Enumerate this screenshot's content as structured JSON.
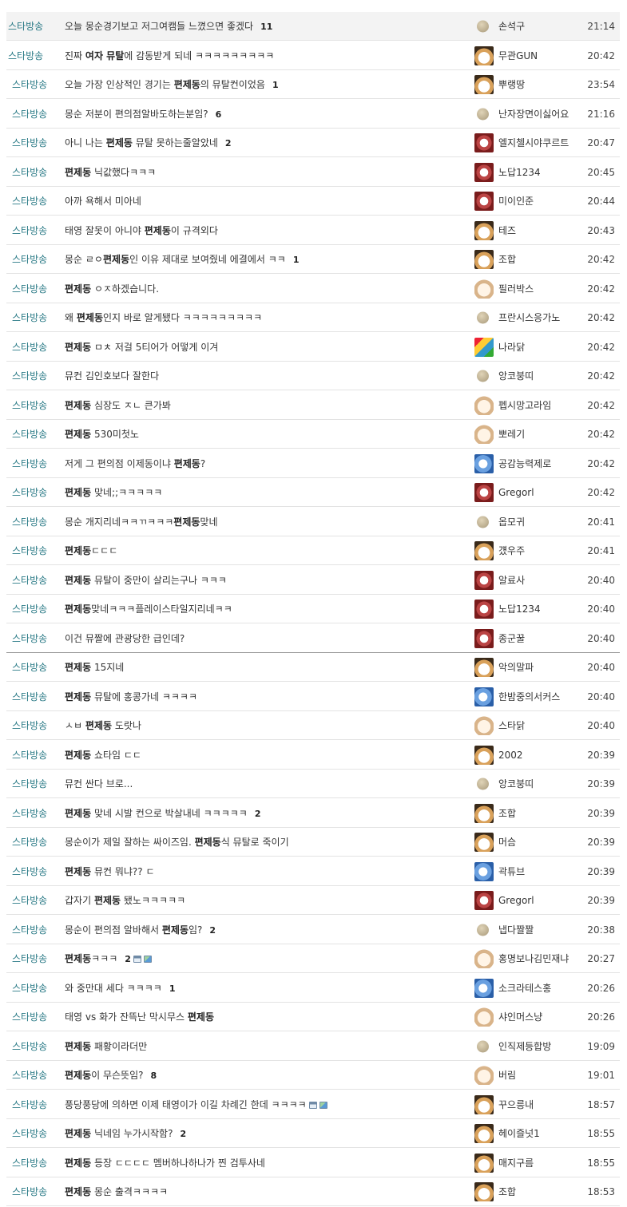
{
  "rows": [
    {
      "cat": "스타방송",
      "parts": [
        {
          "t": "오늘 몽순경기보고 저그여캠들 느꼈으면 좋겠다"
        }
      ],
      "count": "11",
      "author": "손석구",
      "avatar": "dot",
      "time": "21:14"
    },
    {
      "cat": "스타방송",
      "parts": [
        {
          "t": "진짜 "
        },
        {
          "t": "여자 뮤탈",
          "b": true
        },
        {
          "t": "에 감동받게 되네 ㅋㅋㅋㅋㅋㅋㅋㅋㅋ"
        }
      ],
      "author": "무관GUN",
      "avatar": "fox",
      "time": "20:42"
    },
    {
      "cat": "스타방송",
      "parts": [
        {
          "t": "오늘 가장 인상적인 경기는 "
        },
        {
          "t": "편제동",
          "b": true
        },
        {
          "t": "의 뮤탈컨이었음"
        }
      ],
      "count": "1",
      "author": "뿌랭땅",
      "avatar": "fox",
      "time": "23:54"
    },
    {
      "cat": "스타방송",
      "parts": [
        {
          "t": "몽순 저분이 편의점알바도하는분임?"
        }
      ],
      "count": "6",
      "author": "난자장면이싫어요",
      "avatar": "dot",
      "time": "21:16"
    },
    {
      "cat": "스타방송",
      "parts": [
        {
          "t": "아니 나는 "
        },
        {
          "t": "편제동",
          "b": true
        },
        {
          "t": " 뮤탈 못하는줄알았네"
        }
      ],
      "count": "2",
      "author": "엘지첼시야쿠르트",
      "avatar": "red",
      "time": "20:47"
    },
    {
      "cat": "스타방송",
      "parts": [
        {
          "t": "편제동",
          "b": true
        },
        {
          "t": " 닉값했다ㅋㅋㅋ"
        }
      ],
      "author": "노답1234",
      "avatar": "red",
      "time": "20:45"
    },
    {
      "cat": "스타방송",
      "parts": [
        {
          "t": "아까 욕해서 미아네"
        }
      ],
      "author": "미이인준",
      "avatar": "red",
      "time": "20:44"
    },
    {
      "cat": "스타방송",
      "parts": [
        {
          "t": "태영 잘못이 아니야 "
        },
        {
          "t": "편제동",
          "b": true
        },
        {
          "t": "이 규격외다"
        }
      ],
      "author": "테즈",
      "avatar": "fox",
      "time": "20:43"
    },
    {
      "cat": "스타방송",
      "parts": [
        {
          "t": "몽순 ㄹㅇ"
        },
        {
          "t": "편제동",
          "b": true
        },
        {
          "t": "인 이유 제대로 보여줬네 에결에서 ㅋㅋ"
        }
      ],
      "count": "1",
      "author": "조합",
      "avatar": "fox",
      "time": "20:42"
    },
    {
      "cat": "스타방송",
      "parts": [
        {
          "t": "편제동",
          "b": true
        },
        {
          "t": " ㅇㅈ하겠습니다."
        }
      ],
      "author": "필러박스",
      "avatar": "pup",
      "time": "20:42"
    },
    {
      "cat": "스타방송",
      "parts": [
        {
          "t": "왜 "
        },
        {
          "t": "편제동",
          "b": true
        },
        {
          "t": "인지 바로 알게됐다 ㅋㅋㅋㅋㅋㅋㅋㅋㅋ"
        }
      ],
      "author": "프란시스응가노",
      "avatar": "dot",
      "time": "20:42"
    },
    {
      "cat": "스타방송",
      "parts": [
        {
          "t": "편제동",
          "b": true
        },
        {
          "t": " ㅁㅊ 저걸 5티어가 어떻게 이겨"
        }
      ],
      "author": "나라닭",
      "avatar": "col",
      "time": "20:42"
    },
    {
      "cat": "스타방송",
      "parts": [
        {
          "t": "뮤컨 김인호보다 잘한다"
        }
      ],
      "author": "앙코붕띠",
      "avatar": "dot",
      "time": "20:42"
    },
    {
      "cat": "스타방송",
      "parts": [
        {
          "t": "편제동",
          "b": true
        },
        {
          "t": " 심장도 ㅈㄴ 큰가봐"
        }
      ],
      "author": "펩시망고라임",
      "avatar": "pup",
      "time": "20:42"
    },
    {
      "cat": "스타방송",
      "parts": [
        {
          "t": "편제동",
          "b": true
        },
        {
          "t": " 530미첫노"
        }
      ],
      "author": "뽀레기",
      "avatar": "pup",
      "time": "20:42"
    },
    {
      "cat": "스타방송",
      "parts": [
        {
          "t": "저게 그 편의점 이제동이냐 "
        },
        {
          "t": "편제동",
          "b": true
        },
        {
          "t": "?"
        }
      ],
      "author": "공감능력제로",
      "avatar": "blue",
      "time": "20:42"
    },
    {
      "cat": "스타방송",
      "parts": [
        {
          "t": "편제동",
          "b": true
        },
        {
          "t": " 맞네;;ㅋㅋㅋㅋㅋ"
        }
      ],
      "author": "Gregorl",
      "avatar": "red",
      "time": "20:42"
    },
    {
      "cat": "스타방송",
      "parts": [
        {
          "t": "몽순 개지리네ㅋㅋㄲㅋㅋㅋ"
        },
        {
          "t": "편제동",
          "b": true
        },
        {
          "t": "맞네"
        }
      ],
      "author": "옵모귀",
      "avatar": "dot",
      "time": "20:41"
    },
    {
      "cat": "스타방송",
      "parts": [
        {
          "t": "편제동",
          "b": true
        },
        {
          "t": "ㄷㄷㄷ"
        }
      ],
      "author": "걨우주",
      "avatar": "fox",
      "time": "20:41"
    },
    {
      "cat": "스타방송",
      "parts": [
        {
          "t": "편제동",
          "b": true
        },
        {
          "t": " 뮤탈이 중만이 살리는구나 ㅋㅋㅋ"
        }
      ],
      "author": "알료사",
      "avatar": "red",
      "time": "20:40"
    },
    {
      "cat": "스타방송",
      "parts": [
        {
          "t": "편제동",
          "b": true
        },
        {
          "t": "맞네ㅋㅋㅋ플레이스타일지리네ㅋㅋ"
        }
      ],
      "author": "노답1234",
      "avatar": "red",
      "time": "20:40"
    },
    {
      "cat": "스타방송",
      "parts": [
        {
          "t": "이건 뮤짤에 관광당한 급인데?"
        }
      ],
      "author": "종군꿀",
      "avatar": "red",
      "time": "20:40"
    },
    {
      "cat": "스타방송",
      "parts": [
        {
          "t": "편제동",
          "b": true
        },
        {
          "t": " 15지네"
        }
      ],
      "author": "악의말파",
      "avatar": "fox",
      "time": "20:40"
    },
    {
      "cat": "스타방송",
      "parts": [
        {
          "t": "편제동",
          "b": true
        },
        {
          "t": " 뮤탈에 홍콩가네 ㅋㅋㅋㅋ"
        }
      ],
      "author": "한밤중의서커스",
      "avatar": "blue",
      "time": "20:40"
    },
    {
      "cat": "스타방송",
      "parts": [
        {
          "t": "ㅅㅂ "
        },
        {
          "t": "편제동",
          "b": true
        },
        {
          "t": " 도랏나"
        }
      ],
      "author": "스타닭",
      "avatar": "pup",
      "time": "20:40"
    },
    {
      "cat": "스타방송",
      "parts": [
        {
          "t": "편제동",
          "b": true
        },
        {
          "t": " 쇼타임 ㄷㄷ"
        }
      ],
      "author": "2002",
      "avatar": "fox",
      "time": "20:39"
    },
    {
      "cat": "스타방송",
      "parts": [
        {
          "t": "뮤컨 싼다 브로..."
        }
      ],
      "author": "앙코붕띠",
      "avatar": "dot",
      "time": "20:39"
    },
    {
      "cat": "스타방송",
      "parts": [
        {
          "t": "편제동",
          "b": true
        },
        {
          "t": " 맞네 시발 컨으로 박살내네 ㅋㅋㅋㅋㅋ"
        }
      ],
      "count": "2",
      "author": "조합",
      "avatar": "fox",
      "time": "20:39"
    },
    {
      "cat": "스타방송",
      "parts": [
        {
          "t": "몽순이가 제일 잘하는 싸이즈임. "
        },
        {
          "t": "편제동",
          "b": true
        },
        {
          "t": "식 뮤탈로 죽이기"
        }
      ],
      "author": "머슴",
      "avatar": "fox",
      "time": "20:39"
    },
    {
      "cat": "스타방송",
      "parts": [
        {
          "t": "편제동",
          "b": true
        },
        {
          "t": " 뮤컨 뭐냐?? ㄷ"
        }
      ],
      "author": "곽튜브",
      "avatar": "blue",
      "time": "20:39"
    },
    {
      "cat": "스타방송",
      "parts": [
        {
          "t": "갑자기 "
        },
        {
          "t": "편제동",
          "b": true
        },
        {
          "t": " 됐노ㅋㅋㅋㅋㅋ"
        }
      ],
      "author": "Gregorl",
      "avatar": "red",
      "time": "20:39"
    },
    {
      "cat": "스타방송",
      "parts": [
        {
          "t": "몽순이 편의점 알바해서 "
        },
        {
          "t": "편제동",
          "b": true
        },
        {
          "t": "임?"
        }
      ],
      "count": "2",
      "author": "냅다짤짤",
      "avatar": "dot",
      "time": "20:38"
    },
    {
      "cat": "스타방송",
      "parts": [
        {
          "t": "편제동",
          "b": true
        },
        {
          "t": "ㅋㅋㅋ"
        }
      ],
      "count": "2",
      "attach": true,
      "author": "홍명보나김민재냐",
      "avatar": "pup",
      "time": "20:27"
    },
    {
      "cat": "스타방송",
      "parts": [
        {
          "t": "와 중만대 세다 ㅋㅋㅋㅋ"
        }
      ],
      "count": "1",
      "author": "소크라테스홍",
      "avatar": "blue",
      "time": "20:26"
    },
    {
      "cat": "스타방송",
      "parts": [
        {
          "t": "태영 vs 화가 잔뜩난 막시무스 "
        },
        {
          "t": "편제동",
          "b": true
        }
      ],
      "author": "샤인머스냥",
      "avatar": "pup",
      "time": "20:26"
    },
    {
      "cat": "스타방송",
      "parts": [
        {
          "t": "편제동",
          "b": true
        },
        {
          "t": " 패황이라더만"
        }
      ],
      "author": "인직제등합방",
      "avatar": "dot",
      "time": "19:09"
    },
    {
      "cat": "스타방송",
      "parts": [
        {
          "t": "편제동",
          "b": true
        },
        {
          "t": "이 무슨뜻임?"
        }
      ],
      "count": "8",
      "author": "버림",
      "avatar": "pup",
      "time": "19:01"
    },
    {
      "cat": "스타방송",
      "parts": [
        {
          "t": "풍당풍당에 의하면 이제 태영이가 이길 차례긴 한데 ㅋㅋㅋㅋ"
        }
      ],
      "attach": true,
      "author": "꾸으릉내",
      "avatar": "fox",
      "time": "18:57"
    },
    {
      "cat": "스타방송",
      "parts": [
        {
          "t": "편제동",
          "b": true
        },
        {
          "t": " 닉네임 누가시작함?"
        }
      ],
      "count": "2",
      "author": "헤이즐넛1",
      "avatar": "fox",
      "time": "18:55"
    },
    {
      "cat": "스타방송",
      "parts": [
        {
          "t": "편제동",
          "b": true
        },
        {
          "t": " 등장 ㄷㄷㄷㄷ 멤버하나하나가 찐 검투사네"
        }
      ],
      "author": "매지구름",
      "avatar": "fox",
      "time": "18:55"
    },
    {
      "cat": "스타방송",
      "parts": [
        {
          "t": "편제동",
          "b": true
        },
        {
          "t": " 몽순 출격ㅋㅋㅋㅋ"
        }
      ],
      "author": "조합",
      "avatar": "fox",
      "time": "18:53"
    }
  ]
}
